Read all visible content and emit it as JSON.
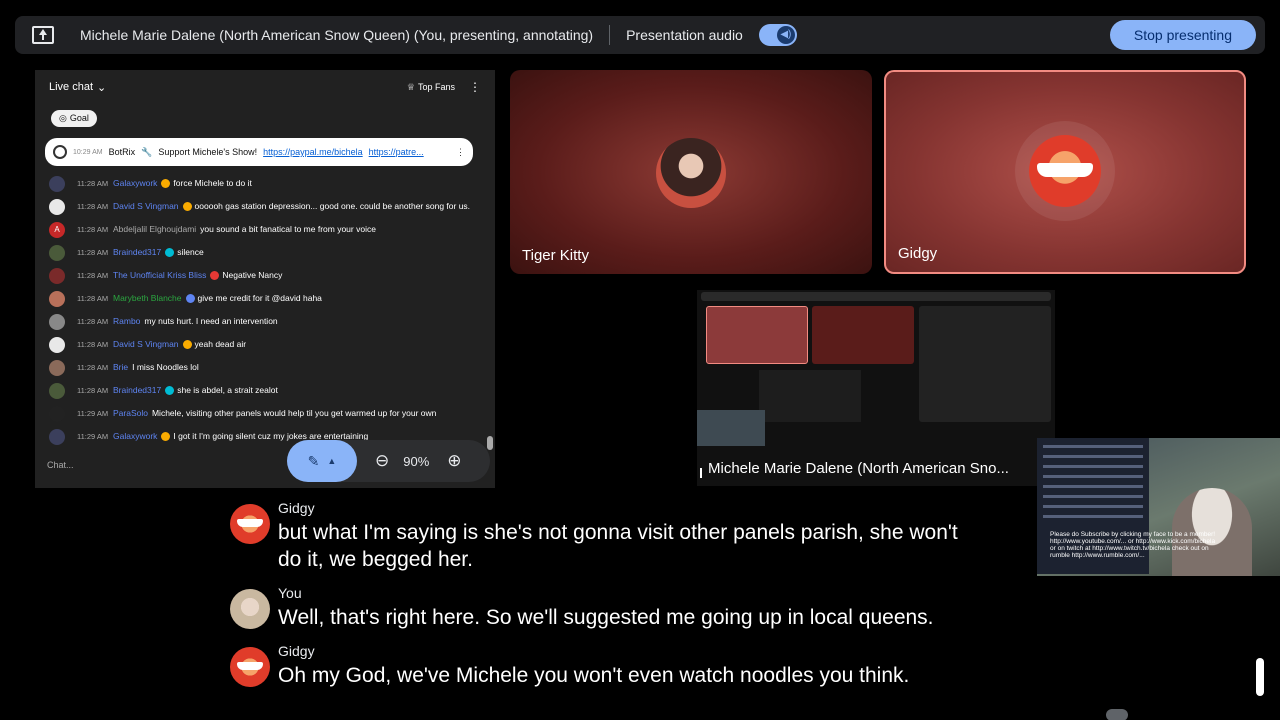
{
  "topbar": {
    "title": "Michele Marie Dalene (North American Snow Queen) (You, presenting, annotating)",
    "audio_label": "Presentation audio",
    "stop_label": "Stop presenting"
  },
  "chat": {
    "header": "Live chat",
    "top_fans": "Top Fans",
    "goal": "Goal",
    "pinned": {
      "time": "10:29 AM",
      "author": "BotRix",
      "text": "Support Michele's Show!",
      "link1": "https://paypal.me/bichela",
      "link2": "https://patre..."
    },
    "messages": [
      {
        "time": "11:28 AM",
        "author": "Galaxywork",
        "text": "force Michele to do it",
        "badge": "#f9ab00"
      },
      {
        "time": "11:28 AM",
        "author": "David S Vingman",
        "text": "oooooh gas station depression... good one. could be another song for us.",
        "badge": "#f9ab00"
      },
      {
        "time": "11:28 AM",
        "author": "Abdeljalil Elghoujdami",
        "text": "you sound a bit fanatical to me from your voice",
        "badge": "",
        "avatar_letter": "A",
        "author_color": "#aaaaaa"
      },
      {
        "time": "11:28 AM",
        "author": "Brainded317",
        "text": "silence",
        "badge": "#00bcd4"
      },
      {
        "time": "11:28 AM",
        "author": "The Unofficial Kriss Bliss",
        "text": "Negative Nancy",
        "badge": "#e53935"
      },
      {
        "time": "11:28 AM",
        "author": "Marybeth Blanche",
        "text": "give me credit for it @david haha",
        "badge": "#5e84f1",
        "author_color": "#2ba640"
      },
      {
        "time": "11:28 AM",
        "author": "Rambo",
        "text": "my nuts hurt. I need an intervention",
        "badge": ""
      },
      {
        "time": "11:28 AM",
        "author": "David S Vingman",
        "text": "yeah dead air",
        "badge": "#f9ab00"
      },
      {
        "time": "11:28 AM",
        "author": "Brie",
        "text": "I miss Noodles lol",
        "badge": ""
      },
      {
        "time": "11:28 AM",
        "author": "Brainded317",
        "text": "she is abdel, a strait zealot",
        "badge": "#00bcd4"
      },
      {
        "time": "11:29 AM",
        "author": "ParaSolo",
        "text": "Michele, visiting other panels would help til you get warmed up for your own",
        "badge": ""
      },
      {
        "time": "11:29 AM",
        "author": "Galaxywork",
        "text": "I got it I'm going silent cuz my jokes are entertaining",
        "badge": "#f9ab00"
      }
    ],
    "input_placeholder": "Chat..."
  },
  "zoom": {
    "level": "90%"
  },
  "tiles": [
    {
      "name": "Tiger Kitty"
    },
    {
      "name": "Gidgy"
    }
  ],
  "selfview": {
    "name": "Michele Marie Dalene (North American Sno..."
  },
  "webcam": {
    "overlay_text": "Please do Subscribe by clicking my face to be a member! http://www.youtube.com/... or http://www.kick.com/bichela or on twitch at http://www.twitch.tv/bichela check out on rumble http://www.rumble.com/..."
  },
  "captions": [
    {
      "speaker": "Gidgy",
      "avatar": "gidgy",
      "lines": [
        "but what I'm saying is she's not gonna visit other panels parish, she won't",
        "do it, we begged her."
      ]
    },
    {
      "speaker": "You",
      "avatar": "you",
      "lines": [
        "Well, that's right here. So we'll suggested me going up in local queens."
      ]
    },
    {
      "speaker": "Gidgy",
      "avatar": "gidgy",
      "lines": [
        "Oh my God, we've Michele you won't even watch noodles you think."
      ]
    }
  ]
}
